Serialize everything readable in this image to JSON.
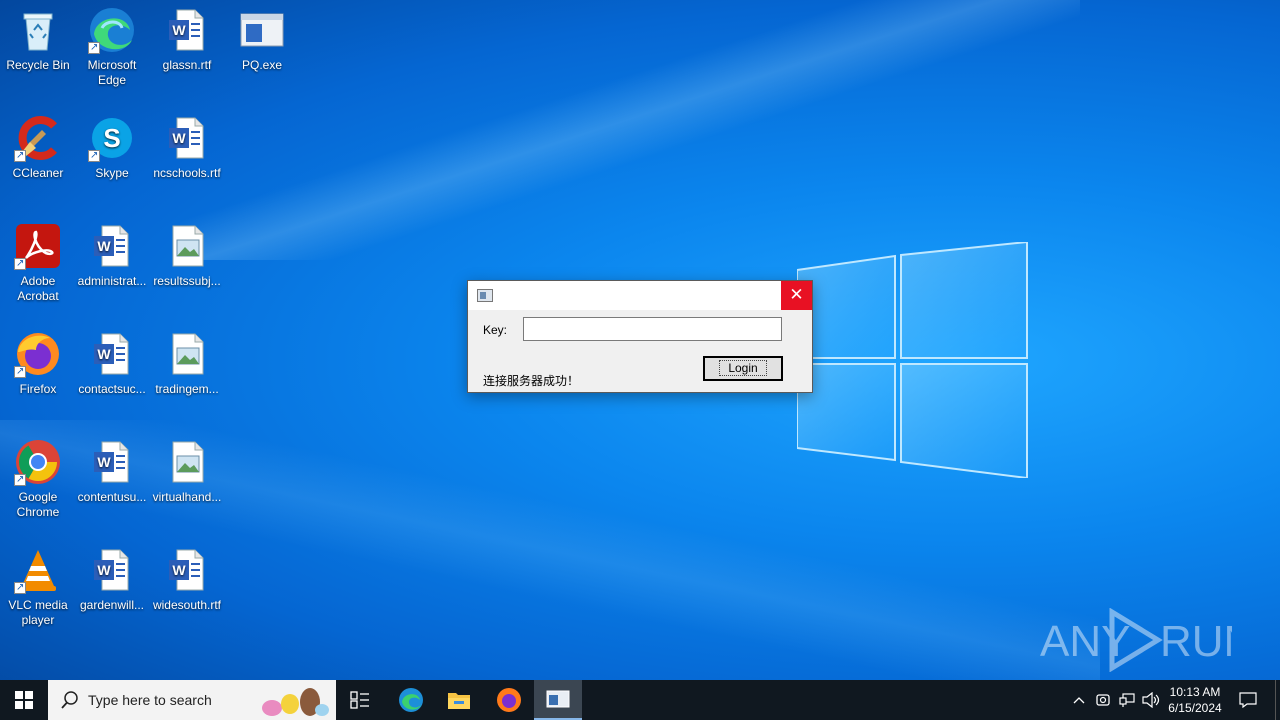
{
  "desktop": {
    "icons": [
      {
        "label": "Recycle Bin",
        "icon": "recycle-bin-icon"
      },
      {
        "label": "Microsoft Edge",
        "icon": "edge-icon"
      },
      {
        "label": "glassn.rtf",
        "icon": "word-doc-icon"
      },
      {
        "label": "PQ.exe",
        "icon": "app-window-icon"
      },
      {
        "label": "CCleaner",
        "icon": "ccleaner-icon"
      },
      {
        "label": "Skype",
        "icon": "skype-icon"
      },
      {
        "label": "ncschools.rtf",
        "icon": "word-doc-icon"
      },
      {
        "label": "Adobe Acrobat",
        "icon": "acrobat-icon"
      },
      {
        "label": "administrat...",
        "icon": "word-doc-icon"
      },
      {
        "label": "resultssubj...",
        "icon": "image-file-icon"
      },
      {
        "label": "Firefox",
        "icon": "firefox-icon"
      },
      {
        "label": "contactsuc...",
        "icon": "word-doc-icon"
      },
      {
        "label": "tradingem...",
        "icon": "image-file-icon"
      },
      {
        "label": "Google Chrome",
        "icon": "chrome-icon"
      },
      {
        "label": "contentusu...",
        "icon": "word-doc-icon"
      },
      {
        "label": "virtualhand...",
        "icon": "image-file-icon"
      },
      {
        "label": "VLC media player",
        "icon": "vlc-icon"
      },
      {
        "label": "gardenwill...",
        "icon": "word-doc-icon"
      },
      {
        "label": "widesouth.rtf",
        "icon": "word-doc-icon"
      }
    ]
  },
  "dialog": {
    "title": "",
    "close_label": "✕",
    "key_label": "Key:",
    "key_value": "",
    "status_text": "连接服务器成功！",
    "login_label": "Login"
  },
  "watermark": {
    "text": "ANY RUN"
  },
  "taskbar": {
    "search_placeholder": "Type here to search",
    "time": "10:13 AM",
    "date": "6/15/2024"
  },
  "colors": {
    "desktop_blue": "#0b86ee",
    "taskbar": "#101820",
    "close_red": "#e81123"
  }
}
